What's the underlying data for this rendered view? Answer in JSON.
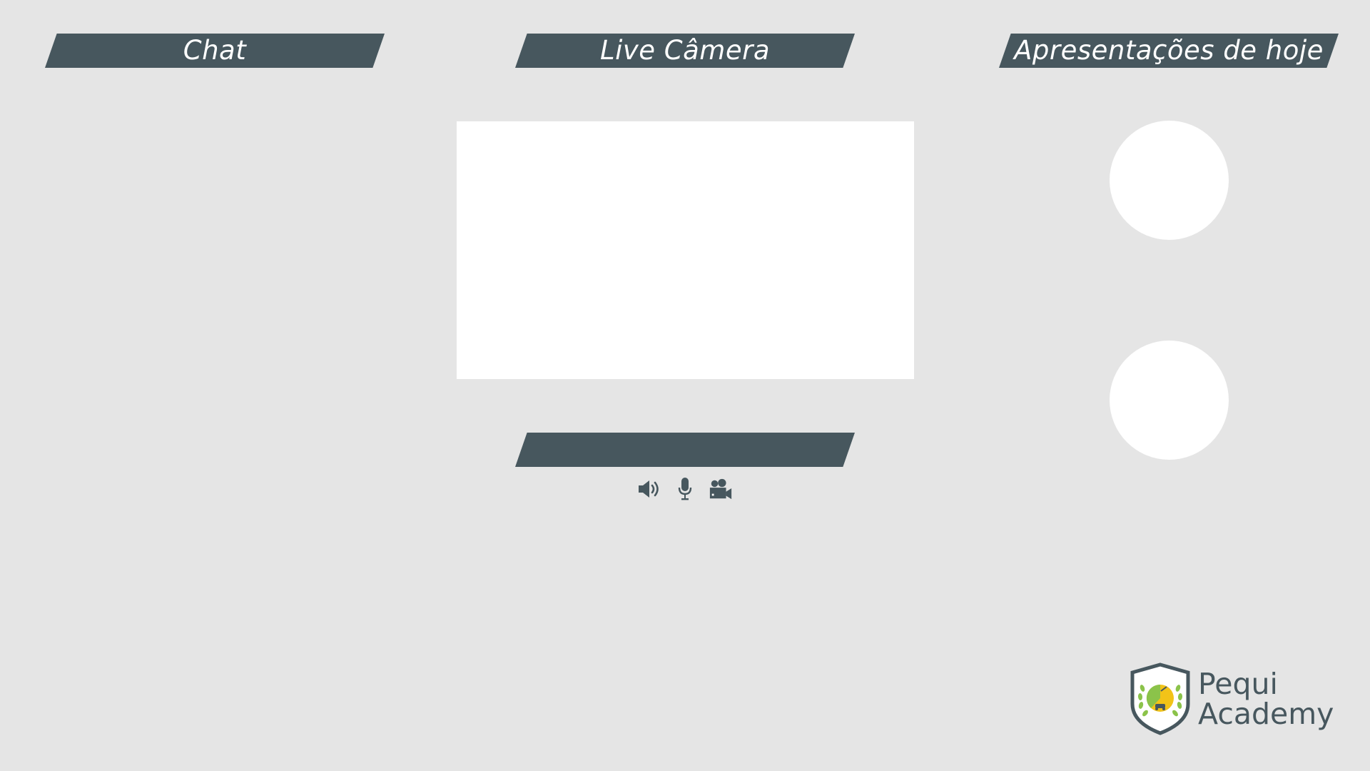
{
  "panels": {
    "chat": {
      "title": "Chat"
    },
    "live_camera": {
      "title": "Live Câmera"
    },
    "presentations": {
      "title": "Apresentações de hoje"
    },
    "status_bar": {
      "title": ""
    }
  },
  "controls": [
    {
      "icon": "speaker-icon"
    },
    {
      "icon": "microphone-icon"
    },
    {
      "icon": "video-camera-icon"
    }
  ],
  "brand": {
    "name_line1": "Pequi",
    "name_line2": "Academy"
  },
  "colors": {
    "background": "#e5e5e5",
    "banner": "#47575e",
    "banner_text": "#ffffff",
    "placeholder": "#ffffff",
    "logo_yellow": "#f2c318",
    "logo_green": "#8bc34a"
  }
}
